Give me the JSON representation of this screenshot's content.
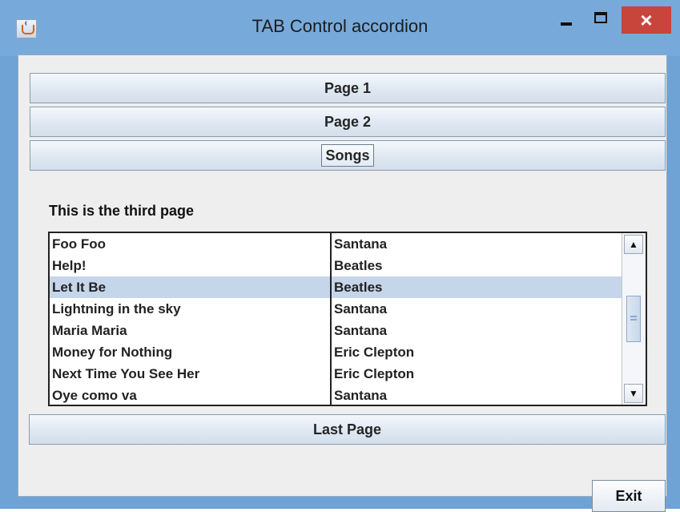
{
  "window": {
    "title": "TAB Control accordion",
    "controls": {
      "minimize": "minimize",
      "maximize": "maximize",
      "close": "×"
    },
    "icon": "java-coffee-icon"
  },
  "accordion": {
    "tabs": [
      {
        "label": "Page 1"
      },
      {
        "label": "Page 2"
      },
      {
        "label": "Songs",
        "active": true
      },
      {
        "label": "Last Page"
      }
    ]
  },
  "songs_page": {
    "heading": "This is the third page",
    "rows": [
      {
        "song": "Foo Foo",
        "artist": "Santana",
        "selected": false
      },
      {
        "song": "Help!",
        "artist": "Beatles",
        "selected": false
      },
      {
        "song": "Let It Be",
        "artist": "Beatles",
        "selected": true
      },
      {
        "song": "Lightning in the sky",
        "artist": "Santana",
        "selected": false
      },
      {
        "song": "Maria Maria",
        "artist": "Santana",
        "selected": false
      },
      {
        "song": "Money for Nothing",
        "artist": "Eric Clepton",
        "selected": false
      },
      {
        "song": "Next Time You See Her",
        "artist": "Eric Clepton",
        "selected": false
      },
      {
        "song": "Oye como va",
        "artist": "Santana",
        "selected": false
      }
    ]
  },
  "footer": {
    "exit_label": "Exit"
  },
  "colors": {
    "title_bar": "#77aadb",
    "close_button": "#c8453b",
    "selection": "#c6d6ea",
    "content_background": "#eeeeee"
  }
}
